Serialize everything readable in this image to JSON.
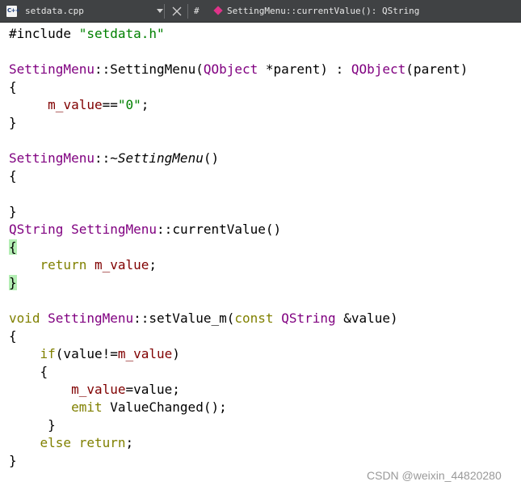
{
  "tab": {
    "file_icon_text": "C++",
    "file_name": "setdata.cpp",
    "hash": "#",
    "symbol": "SettingMenu::currentValue(): QString"
  },
  "code": {
    "l1a": "#include ",
    "l1b": "\"setdata.h\"",
    "l3a": "SettingMenu",
    "l3b": "::SettingMenu(",
    "l3c": "QObject",
    "l3d": " *parent) : ",
    "l3e": "QObject",
    "l3f": "(parent)",
    "l4": "{",
    "l5a": "     ",
    "l5b": "m_value",
    "l5c": "==",
    "l5d": "\"0\"",
    "l5e": ";",
    "l6": "}",
    "l8a": "SettingMenu",
    "l8b": "::",
    "l8c": "~SettingMenu",
    "l8d": "()",
    "l9": "{",
    "l11": "}",
    "l12a": "QString",
    "l12b": " ",
    "l12c": "SettingMenu",
    "l12d": "::currentValue()",
    "l13": "{",
    "l14a": "    ",
    "l14b": "return",
    "l14c": " ",
    "l14d": "m_value",
    "l14e": ";",
    "l15": "}",
    "l17a": "void",
    "l17b": " ",
    "l17c": "SettingMenu",
    "l17d": "::setValue_m(",
    "l17e": "const",
    "l17f": " ",
    "l17g": "QString",
    "l17h": " &value)",
    "l18": "{",
    "l19a": "    ",
    "l19b": "if",
    "l19c": "(value!=",
    "l19d": "m_value",
    "l19e": ")",
    "l20": "    {",
    "l21a": "        ",
    "l21b": "m_value",
    "l21c": "=value;",
    "l22a": "        ",
    "l22b": "emit",
    "l22c": " ValueChanged();",
    "l23": "     }",
    "l24a": "    ",
    "l24b": "else",
    "l24c": " ",
    "l24d": "return",
    "l24e": ";",
    "l25": "}"
  },
  "colors": {
    "keyword": "#808000",
    "type": "#800080",
    "string": "#008000",
    "member": "#800000",
    "brace_match_highlight": "#b4eeb4"
  },
  "watermark": "CSDN @weixin_44820280"
}
